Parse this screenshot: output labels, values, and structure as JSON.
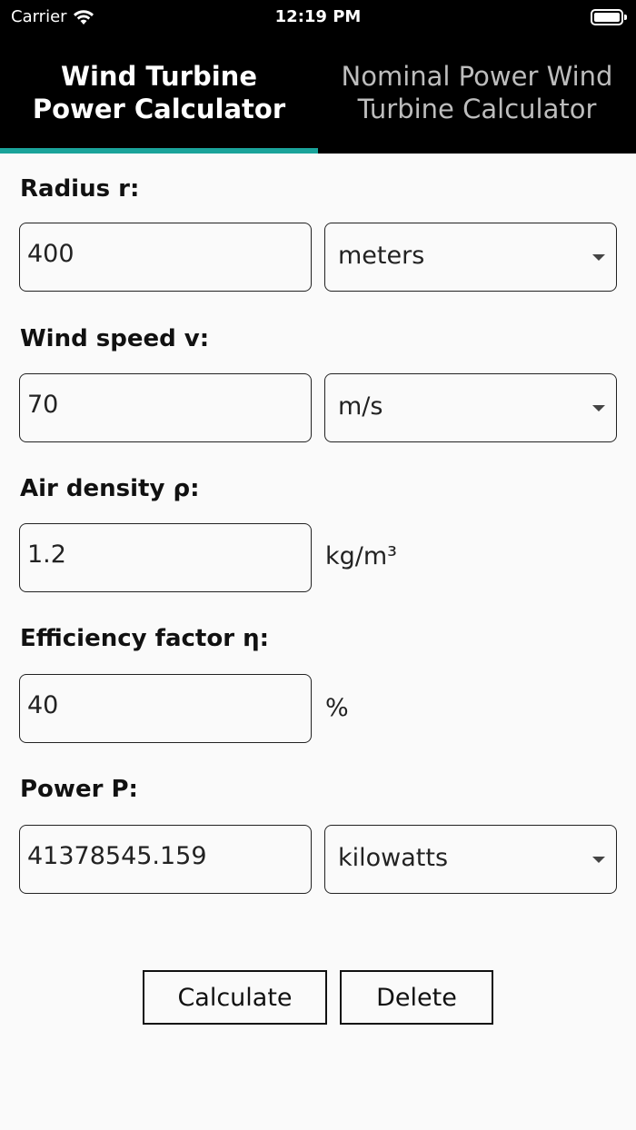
{
  "status_bar": {
    "carrier": "Carrier",
    "time": "12:19 PM",
    "wifi_icon": "wifi-icon",
    "battery_icon": "battery-full-icon"
  },
  "tabs": [
    {
      "label": "Wind Turbine Power Calculator",
      "active": true
    },
    {
      "label": "Nominal Power Wind Turbine Calculator",
      "active": false
    }
  ],
  "accent_color": "#1aa39a",
  "form": {
    "radius": {
      "label": "Radius r:",
      "value": "400",
      "unit": "meters"
    },
    "wind_speed": {
      "label": "Wind speed v:",
      "value": "70",
      "unit": "m/s"
    },
    "air_density": {
      "label": "Air density ρ:",
      "value": "1.2",
      "unit": "kg/m³"
    },
    "efficiency": {
      "label": "Efficiency factor η:",
      "value": "40",
      "unit": "%"
    },
    "power": {
      "label": "Power P:",
      "value": "41378545.159",
      "unit": "kilowatts"
    }
  },
  "buttons": {
    "calculate": "Calculate",
    "delete": "Delete"
  }
}
